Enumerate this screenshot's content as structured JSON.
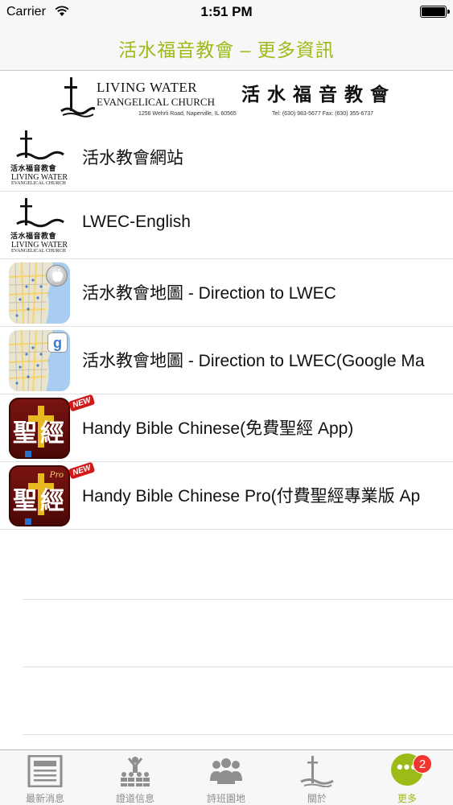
{
  "status_bar": {
    "carrier": "Carrier",
    "time": "1:51 PM"
  },
  "nav": {
    "title": "活水福音教會 – 更多資訊"
  },
  "banner": {
    "name_line1": "LIVING WATER",
    "name_line2": "EVANGELICAL CHURCH",
    "chinese_name": "活水福音教會",
    "address": "1256 Wehrli Road, Naperville, IL 60565",
    "phone": "Tel: (630) 983-5677  Fax: (630) 355-6737"
  },
  "church_icon_text": {
    "chars": "活水福音教會",
    "en1": "LIVING WATER",
    "en2": "EVANGELICAL CHURCH"
  },
  "bible_icon_text": {
    "chars": "聖經",
    "pro": "Pro",
    "new_badge": "NEW"
  },
  "list": {
    "items": [
      {
        "label": "活水教會網站",
        "icon": "church-logo-icon"
      },
      {
        "label": "LWEC-English",
        "icon": "church-logo-icon"
      },
      {
        "label": "活水教會地圖 - Direction to LWEC",
        "icon": "apple-maps-icon"
      },
      {
        "label": "活水教會地圖 - Direction to LWEC(Google Ma",
        "icon": "google-maps-icon"
      },
      {
        "label": "Handy Bible Chinese(免費聖經 App)",
        "icon": "bible-app-icon"
      },
      {
        "label": "Handy Bible Chinese Pro(付費聖經專業版 Ap",
        "icon": "bible-pro-app-icon"
      }
    ]
  },
  "tabs": [
    {
      "label": "最新消息",
      "icon": "newspaper-icon"
    },
    {
      "label": "證道信息",
      "icon": "sermon-icon"
    },
    {
      "label": "詩班園地",
      "icon": "choir-icon"
    },
    {
      "label": "關於",
      "icon": "church-cross-icon"
    },
    {
      "label": "更多",
      "icon": "more-icon",
      "badge": "2",
      "active": true
    }
  ],
  "colors": {
    "accent": "#9cbb18",
    "badge": "#f0352e",
    "tab_inactive": "#8e8e8e"
  }
}
